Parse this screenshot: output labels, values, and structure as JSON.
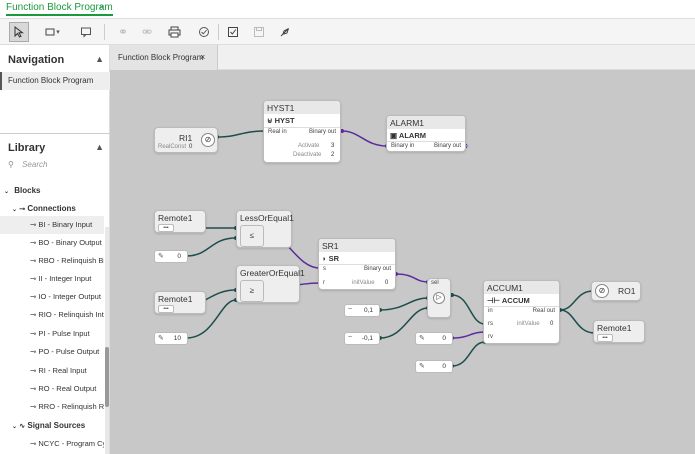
{
  "app_tab": {
    "label": "Function Block Program",
    "close": "×"
  },
  "toolbar": {
    "icons": [
      "select-icon",
      "rectangle-icon",
      "dropdown-icon",
      "comment-icon",
      "link-icon",
      "unlink-icon",
      "print-icon",
      "validate-icon",
      "check-icon",
      "save-icon",
      "deploy-icon"
    ]
  },
  "sidebar": {
    "nav_title": "Navigation",
    "nav_item": "Function Block Program",
    "lib_title": "Library",
    "search_placeholder": "Search",
    "blocks_label": "Blocks",
    "connections_label": "Connections",
    "items": [
      "BI - Binary Input",
      "BO - Binary Output",
      "RBO - Relinquish Bin",
      "II - Integer Input",
      "IO - Integer Output",
      "RIO - Relinquish Inte",
      "PI - Pulse Input",
      "PO - Pulse Output",
      "RI - Real Input",
      "RO - Real Output",
      "RRO - Relinquish Re"
    ],
    "signal_sources_label": "Signal Sources",
    "ncyc_label": "NCYC - Program Cyc"
  },
  "doc_tab": {
    "label": "Function Block Program",
    "close": "×"
  },
  "canvas": {
    "ri1": {
      "title": "RI1",
      "prop": "RealConst",
      "value": "0"
    },
    "hyst1": {
      "title": "HYST1",
      "type": "HYST",
      "in": "Real in",
      "out": "Binary out",
      "activate_lbl": "Activate",
      "activate_val": "3",
      "deactivate_lbl": "Deactivate",
      "deactivate_val": "2"
    },
    "alarm1": {
      "title": "ALARM1",
      "type": "ALARM",
      "in": "Binary in",
      "out": "Binary out"
    },
    "remote1a": {
      "title": "Remote1",
      "dots": "•••"
    },
    "remote1b": {
      "title": "Remote1",
      "dots": "•••"
    },
    "remote1c": {
      "title": "Remote1",
      "dots": "•••"
    },
    "lesseq": {
      "title": "LessOrEqual1",
      "sym": "≤"
    },
    "greatereq": {
      "title": "GreaterOrEqual1",
      "sym": "≥"
    },
    "sr1": {
      "title": "SR1",
      "type": "SR",
      "s": "s",
      "r": "r",
      "out": "Binary out",
      "init_lbl": "initValue",
      "init_val": "0"
    },
    "accum1": {
      "title": "ACCUM1",
      "type": "ACCUM",
      "in": "in",
      "rs": "rs",
      "rv": "rv",
      "out": "Real out",
      "init_lbl": "initValue",
      "init_val": "0"
    },
    "ro1": {
      "title": "RO1"
    },
    "const_0a": "0",
    "const_10": "10",
    "const_01": "0,1",
    "const_m01": "-0,1",
    "const_0b": "0",
    "const_0c": "0",
    "sel_lbl": "sel"
  }
}
